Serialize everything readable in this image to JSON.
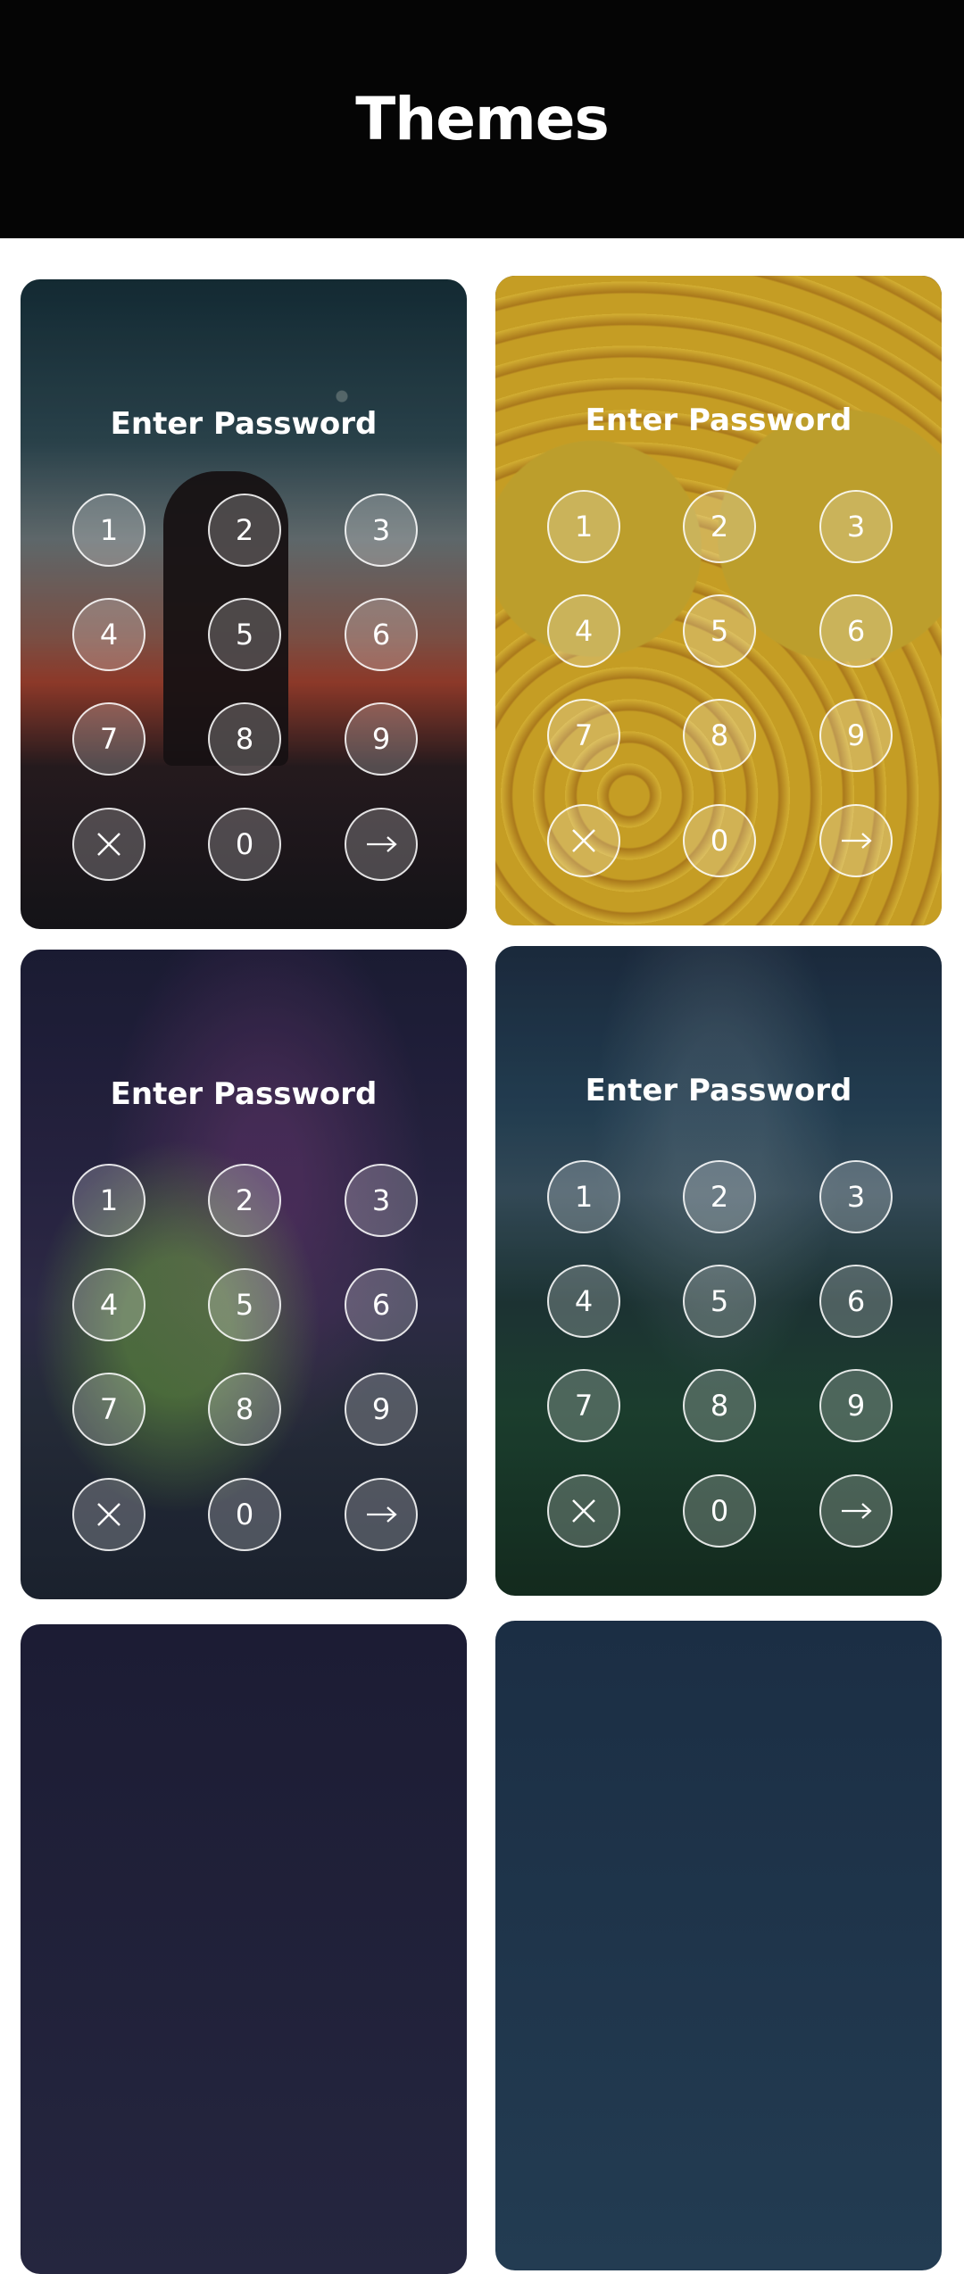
{
  "header": {
    "title": "Themes"
  },
  "themes": [
    {
      "title": "Enter Password",
      "keys": [
        "1",
        "2",
        "3",
        "4",
        "5",
        "6",
        "7",
        "8",
        "9",
        "0"
      ]
    },
    {
      "title": "Enter Password",
      "keys": [
        "1",
        "2",
        "3",
        "4",
        "5",
        "6",
        "7",
        "8",
        "9",
        "0"
      ]
    },
    {
      "title": "Enter Password",
      "keys": [
        "1",
        "2",
        "3",
        "4",
        "5",
        "6",
        "7",
        "8",
        "9",
        "0"
      ]
    },
    {
      "title": "Enter Password",
      "keys": [
        "1",
        "2",
        "3",
        "4",
        "5",
        "6",
        "7",
        "8",
        "9",
        "0"
      ]
    }
  ],
  "icons": {
    "clear": "close-icon",
    "submit": "arrow-right-icon"
  }
}
